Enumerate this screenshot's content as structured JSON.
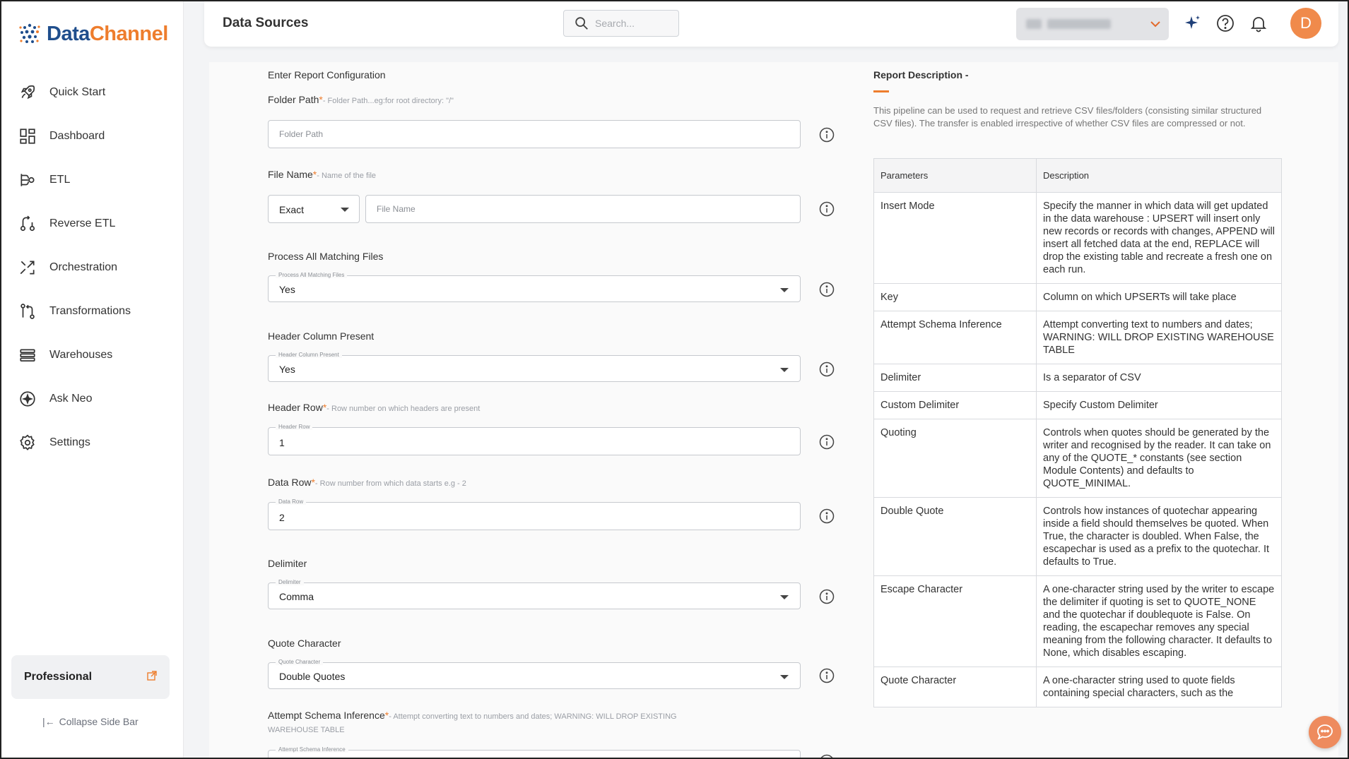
{
  "app": {
    "logo_text_1": "Data",
    "logo_text_2": "Channel"
  },
  "sidebar": {
    "items": [
      {
        "label": "Quick Start",
        "icon": "rocket-icon"
      },
      {
        "label": "Dashboard",
        "icon": "dashboard-icon"
      },
      {
        "label": "ETL",
        "icon": "etl-icon"
      },
      {
        "label": "Reverse ETL",
        "icon": "reverse-etl-icon"
      },
      {
        "label": "Orchestration",
        "icon": "orchestration-icon"
      },
      {
        "label": "Transformations",
        "icon": "transformations-icon"
      },
      {
        "label": "Warehouses",
        "icon": "warehouses-icon"
      },
      {
        "label": "Ask Neo",
        "icon": "sparkle-icon"
      },
      {
        "label": "Settings",
        "icon": "gear-icon"
      }
    ],
    "plan": "Professional",
    "collapse": "Collapse Side Bar"
  },
  "header": {
    "title": "Data Sources",
    "search_placeholder": "Search..."
  },
  "form": {
    "section": "Enter Report Configuration",
    "folder_path": {
      "label": "Folder Path",
      "hint": "- Folder Path...eg:for root directory: \"/\"",
      "placeholder": "Folder Path"
    },
    "file_name": {
      "label": "File Name",
      "hint": "- Name of the file",
      "match": "Exact",
      "placeholder": "File Name"
    },
    "process_all": {
      "label": "Process All Matching Files",
      "float": "Process All Matching Files",
      "value": "Yes"
    },
    "header_col": {
      "label": "Header Column Present",
      "float": "Header Column Present",
      "value": "Yes"
    },
    "header_row": {
      "label": "Header Row",
      "hint": "- Row number on which headers are present",
      "float": "Header Row",
      "value": "1"
    },
    "data_row": {
      "label": "Data Row",
      "hint": "- Row number from which data starts e.g - 2",
      "float": "Data Row",
      "value": "2"
    },
    "delimiter": {
      "label": "Delimiter",
      "float": "Delimiter",
      "value": "Comma"
    },
    "quote_char": {
      "label": "Quote Character",
      "float": "Quote Character",
      "value": "Double Quotes"
    },
    "schema_inference": {
      "label": "Attempt Schema Inference",
      "hint_1": "- Attempt converting text to numbers and dates; WARNING: WILL DROP EXISTING",
      "hint_2": "WAREHOUSE TABLE",
      "float": "Attempt Schema Inference"
    }
  },
  "description": {
    "title": "Report Description -",
    "text": "This pipeline can be used to request and retrieve CSV files/folders (consisting similar structured CSV files). The transfer is enabled irrespective of whether CSV files are compressed or not.",
    "headers": [
      "Parameters",
      "Description"
    ],
    "rows": [
      {
        "param": "Insert Mode",
        "desc": "Specify the manner in which data will get updated in the data warehouse : UPSERT will insert only new records or records with changes, APPEND will insert all fetched data at the end, REPLACE will drop the existing table and recreate a fresh one on each run."
      },
      {
        "param": "Key",
        "desc": "Column on which UPSERTs will take place"
      },
      {
        "param": "Attempt Schema Inference",
        "desc": "Attempt converting text to numbers and dates; WARNING: WILL DROP EXISTING WAREHOUSE TABLE"
      },
      {
        "param": "Delimiter",
        "desc": "Is a separator of CSV"
      },
      {
        "param": "Custom Delimiter",
        "desc": "Specify Custom Delimiter"
      },
      {
        "param": "Quoting",
        "desc": "Controls when quotes should be generated by the writer and recognised by the reader. It can take on any of the QUOTE_* constants (see section Module Contents) and defaults to QUOTE_MINIMAL."
      },
      {
        "param": "Double Quote",
        "desc": "Controls how instances of quotechar appearing inside a field should themselves be quoted. When True, the character is doubled. When False, the escapechar is used as a prefix to the quotechar. It defaults to True."
      },
      {
        "param": "Escape Character",
        "desc": "A one-character string used by the writer to escape the delimiter if quoting is set to QUOTE_NONE and the quotechar if doublequote is False. On reading, the escapechar removes any special meaning from the following character. It defaults to None, which disables escaping."
      },
      {
        "param": "Quote Character",
        "desc": "A one-character string used to quote fields containing special characters, such as the"
      }
    ]
  },
  "colors": {
    "accent": "#ee7d2d",
    "brand_blue": "#1f4e8c",
    "avatar": "#f08a4b"
  },
  "user": {
    "initial": "D"
  }
}
